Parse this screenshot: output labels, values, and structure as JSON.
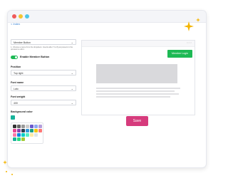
{
  "nav": {
    "back_link": "< Index"
  },
  "form": {
    "member_select": "Member Button",
    "hint": "1. Choose a name from the dropdown. Inserts after 7 to 8 just present in the preview to edit it.",
    "toggle_label": "Enable Member Button",
    "position_label": "Position",
    "position_value": "Top right",
    "font_name_label": "Font name",
    "font_name_value": "Lato",
    "font_weight_label": "Font weight",
    "font_weight_value": "400",
    "bg_color_label": "Background color"
  },
  "preview": {
    "button_label": "Member Login",
    "close_glyph": "○ ○ ○"
  },
  "actions": {
    "save_label": "Save"
  },
  "colors": {
    "accent": "#1db954",
    "save": "#d63b7c",
    "selected_swatch": "#17b29a"
  }
}
